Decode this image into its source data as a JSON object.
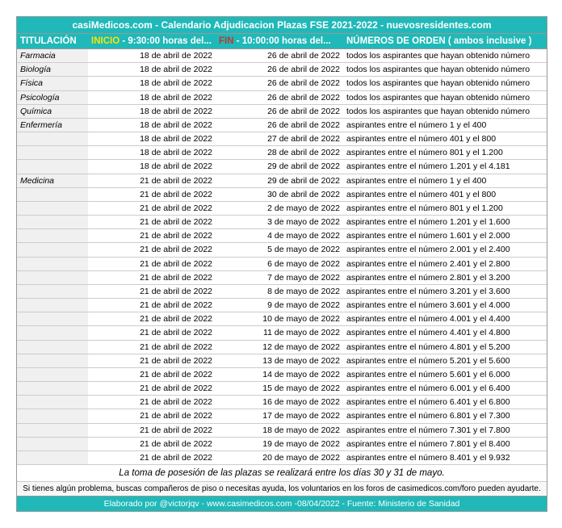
{
  "title": "casiMedicos.com - Calendario Adjudicacion Plazas FSE 2021-2022 - nuevosresidentes.com",
  "header": {
    "col1": "TITULACIÓN",
    "col2a": "INICIO",
    "col2b": " - 9:30:00 horas del...",
    "col3a": "FIN",
    "col3b": " - 10:00:00 horas del...",
    "col4a": "NÚMEROS DE ORDEN",
    "col4b": " ( ambos inclusive )"
  },
  "rows": [
    {
      "tit": "Farmacia",
      "ini": "18 de abril de 2022",
      "fin": "26 de abril de 2022",
      "num": "todos los aspirantes que hayan obtenido número"
    },
    {
      "tit": "Biología",
      "ini": "18 de abril de 2022",
      "fin": "26 de abril de 2022",
      "num": "todos los aspirantes que hayan obtenido número"
    },
    {
      "tit": "Física",
      "ini": "18 de abril de 2022",
      "fin": "26 de abril de 2022",
      "num": "todos los aspirantes que hayan obtenido número"
    },
    {
      "tit": "Psicología",
      "ini": "18 de abril de 2022",
      "fin": "26 de abril de 2022",
      "num": "todos los aspirantes que hayan obtenido número"
    },
    {
      "tit": "Química",
      "ini": "18 de abril de 2022",
      "fin": "26 de abril de 2022",
      "num": "todos los aspirantes que hayan obtenido número"
    },
    {
      "tit": "Enfermería",
      "ini": "18 de abril de 2022",
      "fin": "26 de abril de 2022",
      "num": "aspirantes  entre el número 1 y el 400"
    },
    {
      "tit": "",
      "ini": "18 de abril de 2022",
      "fin": "27 de abril de 2022",
      "num": "aspirantes  entre el número 401 y el 800"
    },
    {
      "tit": "",
      "ini": "18 de abril de 2022",
      "fin": "28 de abril de 2022",
      "num": "aspirantes  entre el número 801 y el 1.200"
    },
    {
      "tit": "",
      "ini": "18 de abril de 2022",
      "fin": "29 de abril de 2022",
      "num": "aspirantes  entre el número 1.201 y el 4.181"
    },
    {
      "tit": "Medicina",
      "ini": "21 de abril de 2022",
      "fin": "29 de abril de 2022",
      "num": "aspirantes  entre el número 1 y el 400"
    },
    {
      "tit": "",
      "ini": "21 de abril de 2022",
      "fin": "30 de abril de 2022",
      "num": "aspirantes  entre el número 401 y el 800"
    },
    {
      "tit": "",
      "ini": "21 de abril de 2022",
      "fin": "2 de mayo de 2022",
      "num": "aspirantes  entre el número 801 y el 1.200"
    },
    {
      "tit": "",
      "ini": "21 de abril de 2022",
      "fin": "3 de mayo de 2022",
      "num": "aspirantes  entre el número 1.201 y el 1.600"
    },
    {
      "tit": "",
      "ini": "21 de abril de 2022",
      "fin": "4 de mayo de 2022",
      "num": "aspirantes  entre el número 1.601 y el 2.000"
    },
    {
      "tit": "",
      "ini": "21 de abril de 2022",
      "fin": "5 de mayo de 2022",
      "num": "aspirantes  entre el número 2.001 y el 2.400"
    },
    {
      "tit": "",
      "ini": "21 de abril de 2022",
      "fin": "6 de mayo de 2022",
      "num": "aspirantes  entre el número 2.401 y el 2.800"
    },
    {
      "tit": "",
      "ini": "21 de abril de 2022",
      "fin": "7 de mayo de 2022",
      "num": "aspirantes  entre el número 2.801 y el 3.200"
    },
    {
      "tit": "",
      "ini": "21 de abril de 2022",
      "fin": "8 de mayo de 2022",
      "num": "aspirantes  entre el número 3.201 y el 3.600"
    },
    {
      "tit": "",
      "ini": "21 de abril de 2022",
      "fin": "9 de mayo de 2022",
      "num": "aspirantes  entre el número 3.601 y el 4.000"
    },
    {
      "tit": "",
      "ini": "21 de abril de 2022",
      "fin": "10 de mayo de 2022",
      "num": "aspirantes  entre el número 4.001 y el 4.400"
    },
    {
      "tit": "",
      "ini": "21 de abril de 2022",
      "fin": "11 de mayo de 2022",
      "num": "aspirantes  entre el número 4.401 y el 4.800"
    },
    {
      "tit": "",
      "ini": "21 de abril de 2022",
      "fin": "12 de mayo de 2022",
      "num": "aspirantes  entre el número 4.801 y el 5.200"
    },
    {
      "tit": "",
      "ini": "21 de abril de 2022",
      "fin": "13 de mayo de 2022",
      "num": "aspirantes  entre el número 5.201 y el 5.600"
    },
    {
      "tit": "",
      "ini": "21 de abril de 2022",
      "fin": "14 de mayo de 2022",
      "num": "aspirantes  entre el número 5.601 y el 6.000"
    },
    {
      "tit": "",
      "ini": "21 de abril de 2022",
      "fin": "15 de mayo de 2022",
      "num": "aspirantes  entre el número 6.001 y el 6.400"
    },
    {
      "tit": "",
      "ini": "21 de abril de 2022",
      "fin": "16 de mayo de 2022",
      "num": "aspirantes  entre el número 6.401 y el 6.800"
    },
    {
      "tit": "",
      "ini": "21 de abril de 2022",
      "fin": "17 de mayo de 2022",
      "num": "aspirantes  entre el número 6.801 y el 7.300"
    },
    {
      "tit": "",
      "ini": "21 de abril de 2022",
      "fin": "18 de mayo de 2022",
      "num": "aspirantes  entre el número 7.301 y el 7.800"
    },
    {
      "tit": "",
      "ini": "21 de abril de 2022",
      "fin": "19 de mayo de 2022",
      "num": "aspirantes  entre el número 7.801 y el 8.400"
    },
    {
      "tit": "",
      "ini": "21 de abril de 2022",
      "fin": "20 de mayo de 2022",
      "num": "aspirantes  entre el número 8.401 y el 9.932"
    }
  ],
  "footer1": "La toma de posesión de las plazas se realizará entre los días 30 y 31 de mayo.",
  "footer2": "Si tienes algún problema, buscas compañeros de piso o necesitas ayuda, los voluntarios en los foros de casimedicos.com/foro pueden ayudarte.",
  "footer3": "Elaborado por @victorjqv - www.casimedicos.com -08/04/2022 - Fuente: Ministerio de Sanidad"
}
